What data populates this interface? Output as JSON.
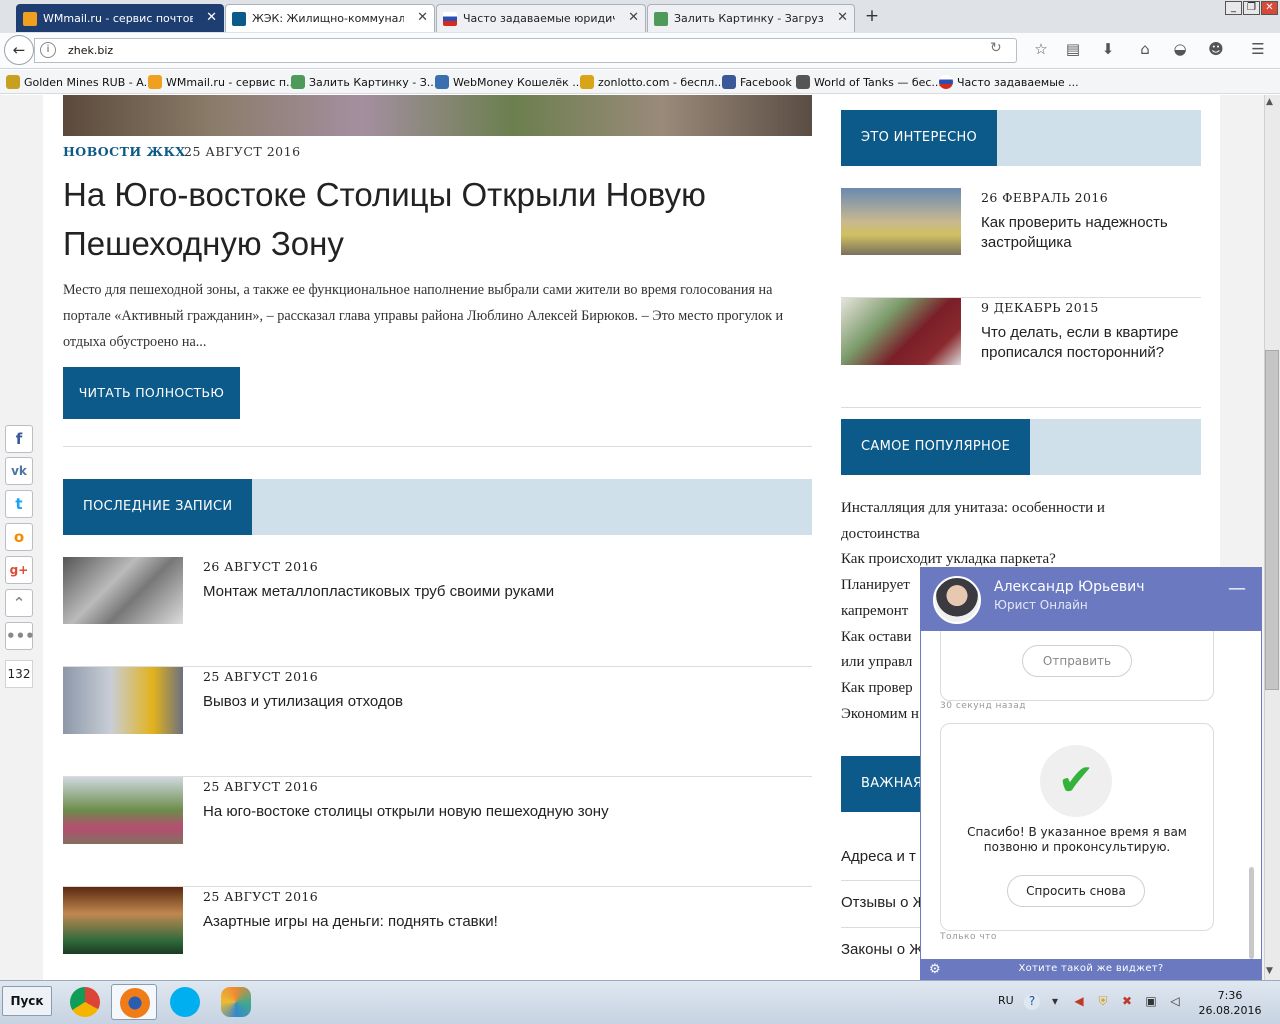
{
  "browser": {
    "tabs": [
      {
        "title": "WMmail.ru - сервис почтовы...",
        "icon": "wmmail-icon"
      },
      {
        "title": "ЖЭК: Жилищно-коммунальн...",
        "icon": "zhek-icon"
      },
      {
        "title": "Часто задаваемые юридич...",
        "icon": "russia-flag-icon"
      },
      {
        "title": "Залить Картинку - Загрузи...",
        "icon": "image-upload-icon"
      }
    ],
    "url": "zhek.biz",
    "bookmarks": [
      "Golden Mines RUB - A...",
      "WMmail.ru - сервис п...",
      "Залить Картинку - З...",
      "WebMoney Кошелёк ...",
      "zonlotto.com - беспл...",
      "Facebook",
      "World of Tanks — бес...",
      "Часто задаваемые ..."
    ]
  },
  "article": {
    "category": "НОВОСТИ ЖКХ",
    "date": "25 АВГУСТ 2016",
    "title": "На Юго-востоке Столицы Открыли Новую Пешеходную Зону",
    "excerpt": "Место для пешеходной зоны, а также ее функциональное наполнение выбрали сами жители во время голосования на портале «Активный гражданин», – рассказал глава управы района Люблино Алексей Бирюков. – Это место прогулок и отдыха обустроено на...",
    "read_more": "ЧИТАТЬ ПОЛНОСТЬЮ"
  },
  "recent": {
    "heading": "ПОСЛЕДНИЕ ЗАПИСИ",
    "posts": [
      {
        "date": "26 АВГУСТ 2016",
        "title": "Монтаж металлопластиковых труб своими руками"
      },
      {
        "date": "25 АВГУСТ 2016",
        "title": "Вывоз и утилизация отходов"
      },
      {
        "date": "25 АВГУСТ 2016",
        "title": "На юго-востоке столицы открыли новую пешеходную зону"
      },
      {
        "date": "25 АВГУСТ 2016",
        "title": "Азартные игры на деньги: поднять ставки!"
      }
    ]
  },
  "sidebar": {
    "interesting": {
      "heading": "ЭТО ИНТЕРЕСНО",
      "items": [
        {
          "date": "26 ФЕВРАЛЬ 2016",
          "title": "Как проверить надежность застройщика"
        },
        {
          "date": "9 ДЕКАБРЬ 2015",
          "title": "Что делать, если в квартире прописался посторонний?"
        }
      ]
    },
    "popular": {
      "heading": "САМОЕ ПОПУЛЯРНОЕ",
      "lines": [
        "Инсталляция для унитаза: особенности и",
        "достоинства",
        "Как происходит укладка паркета?",
        "Планирует",
        "капремонт",
        "Как остави",
        "или управл",
        "Как провер",
        "Экономим н"
      ]
    },
    "important": {
      "heading": "ВАЖНАЯ",
      "items": [
        "Адреса и т",
        "Отзывы о Ж",
        "Законы о Ж"
      ]
    }
  },
  "share": {
    "buttons": [
      "facebook",
      "vkontakte",
      "twitter",
      "odnoklassniki",
      "google-plus",
      "collapse",
      "more"
    ],
    "count": "132"
  },
  "chat": {
    "name": "Александр Юрьевич",
    "role": "Юрист Онлайн",
    "send_label": "Отправить",
    "time1": "30 секунд назад",
    "thanks": "Спасибо! В указанное время я вам позвоню и проконсультирую.",
    "ask_again": "Спросить снова",
    "time2": "Только что",
    "footer": "Хотите такой же виджет?"
  },
  "taskbar": {
    "start": "Пуск",
    "apps": [
      "chrome",
      "firefox",
      "skype",
      "paint"
    ],
    "lang": "RU",
    "time": "7:36",
    "date": "26.08.2016"
  },
  "colors": {
    "accent": "#0c5a8a",
    "section_bg": "#cfe0ea",
    "chat": "#6a79c0"
  }
}
